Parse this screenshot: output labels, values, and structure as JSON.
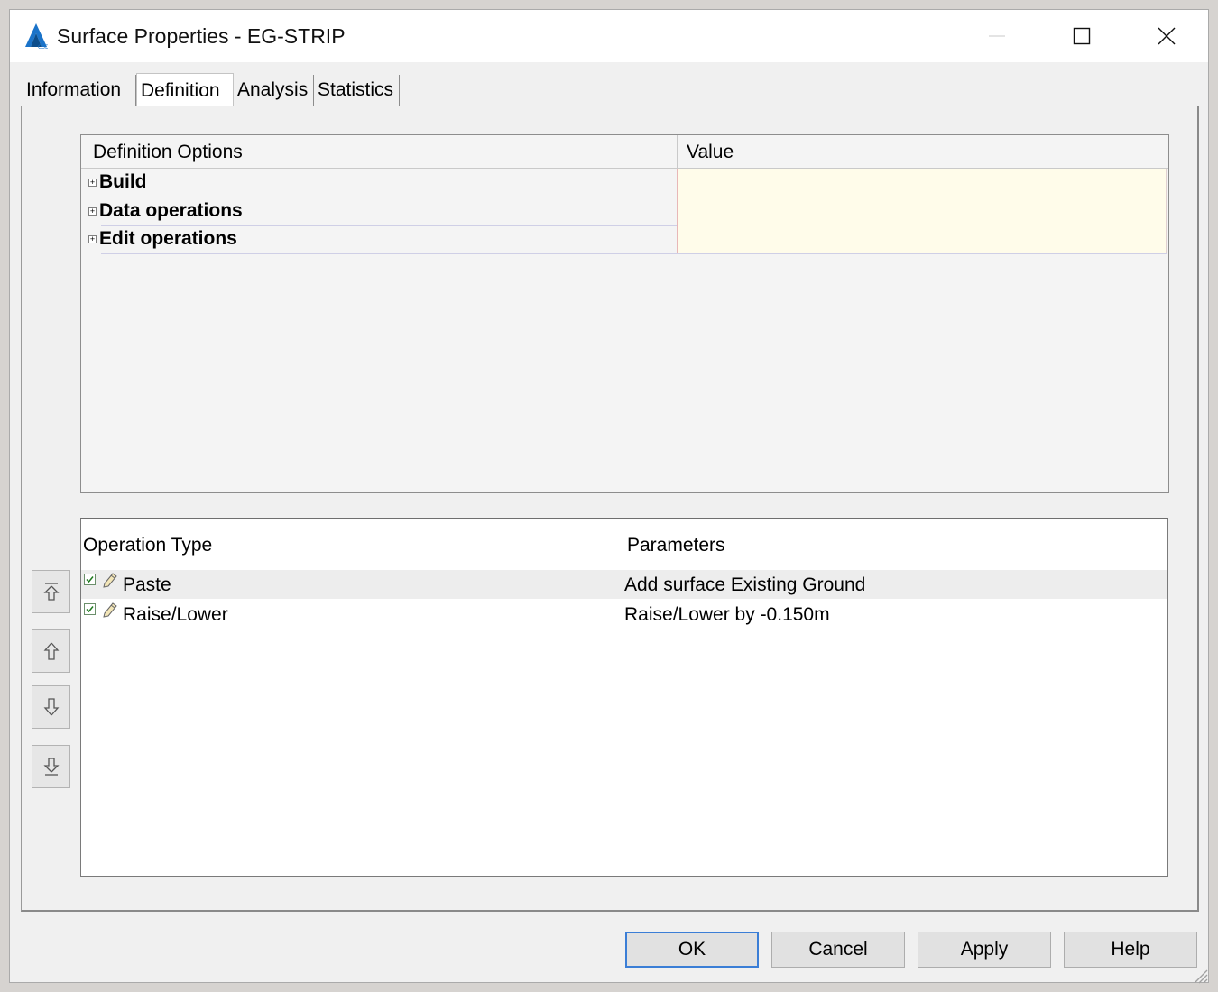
{
  "window": {
    "title": "Surface Properties - EG-STRIP",
    "icon": "autocad-civil3d-icon"
  },
  "tabs": [
    {
      "label": "Information",
      "active": false
    },
    {
      "label": "Definition",
      "active": true
    },
    {
      "label": "Analysis",
      "active": false
    },
    {
      "label": "Statistics",
      "active": false
    }
  ],
  "definition_grid": {
    "columns": [
      "Definition Options",
      "Value"
    ],
    "rows": [
      {
        "label": "Build",
        "value": ""
      },
      {
        "label": "Data operations",
        "value": ""
      },
      {
        "label": "Edit operations",
        "value": ""
      }
    ]
  },
  "operations_grid": {
    "columns": [
      "Operation Type",
      "Parameters"
    ],
    "rows": [
      {
        "type": "Paste",
        "parameters": "Add surface Existing Ground",
        "checked": true,
        "selected": true
      },
      {
        "type": "Raise/Lower",
        "parameters": "Raise/Lower by -0.150m",
        "checked": true,
        "selected": false
      }
    ]
  },
  "side_buttons": [
    "move-to-top-icon",
    "move-up-icon",
    "move-down-icon",
    "move-to-bottom-icon"
  ],
  "footer": {
    "ok": "OK",
    "cancel": "Cancel",
    "apply": "Apply",
    "help": "Help"
  },
  "colors": {
    "value_cell": "#fffcea",
    "default_button_border": "#3b7ed6",
    "selected_row": "#ededed"
  }
}
